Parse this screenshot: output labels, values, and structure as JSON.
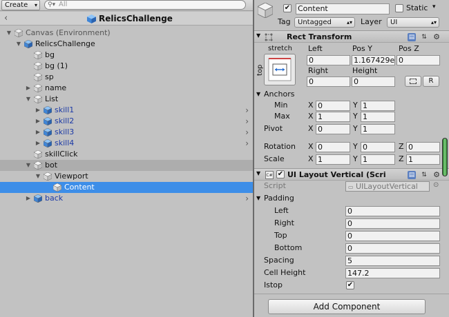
{
  "hierarchy": {
    "create_label": "Create",
    "search_placeholder": "All",
    "scene_title": "RelicsChallenge",
    "items": [
      {
        "label": "Canvas (Environment)"
      },
      {
        "label": "RelicsChallenge"
      },
      {
        "label": "bg"
      },
      {
        "label": "bg (1)"
      },
      {
        "label": "sp"
      },
      {
        "label": "name"
      },
      {
        "label": "List"
      },
      {
        "label": "skill1"
      },
      {
        "label": "skill2"
      },
      {
        "label": "skill3"
      },
      {
        "label": "skill4"
      },
      {
        "label": "skillClick"
      },
      {
        "label": "bot"
      },
      {
        "label": "Viewport"
      },
      {
        "label": "Content"
      },
      {
        "label": "back"
      }
    ]
  },
  "inspector": {
    "object_name": "Content",
    "active_checked": true,
    "static_label": "Static",
    "tag_label": "Tag",
    "tag_value": "Untagged",
    "layer_label": "Layer",
    "layer_value": "UI",
    "rect_transform": {
      "title": "Rect Transform",
      "anchor_preset_top": "stretch",
      "anchor_preset_side": "top",
      "col_left": "Left",
      "col_posy": "Pos Y",
      "col_posz": "Pos Z",
      "val_left": "0",
      "val_posy": "1.167429e",
      "val_posz": "0",
      "col_right": "Right",
      "col_height": "Height",
      "val_right": "0",
      "val_height": "0",
      "r_button": "R",
      "anchors_label": "Anchors",
      "min_label": "Min",
      "max_label": "Max",
      "pivot_label": "Pivot",
      "x": "X",
      "y": "Y",
      "z": "Z",
      "min_x": "0",
      "min_y": "1",
      "max_x": "1",
      "max_y": "1",
      "pivot_x": "0",
      "pivot_y": "1",
      "rotation_label": "Rotation",
      "rot_x": "0",
      "rot_y": "0",
      "rot_z": "0",
      "scale_label": "Scale",
      "scale_x": "1",
      "scale_y": "1",
      "scale_z": "1"
    },
    "layout": {
      "title": "UI Layout Vertical (Scri",
      "script_label": "Script",
      "script_value": "UILayoutVertical",
      "padding_label": "Padding",
      "left_label": "Left",
      "right_label": "Right",
      "top_label": "Top",
      "bottom_label": "Bottom",
      "left_val": "0",
      "right_val": "0",
      "top_val": "0",
      "bottom_val": "0",
      "spacing_label": "Spacing",
      "spacing_val": "5",
      "cell_height_label": "Cell Height",
      "cell_height_val": "147.2",
      "istop_label": "Istop",
      "istop_checked": true
    },
    "add_component_label": "Add Component"
  },
  "colors": {
    "selection": "#3d8ee8",
    "panel": "#c2c2c2",
    "prefab_blue": "#1c3aa6"
  }
}
